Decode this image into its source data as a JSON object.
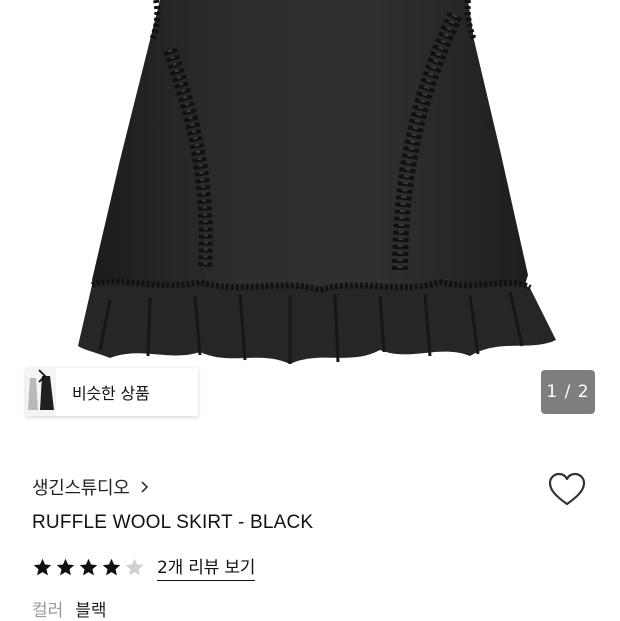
{
  "gallery": {
    "similar_products_label": "비슷한 상품",
    "page_counter": "1 / 2"
  },
  "product": {
    "brand": "생긴스튜디오",
    "title": "RUFFLE WOOL SKIRT - BLACK",
    "rating_stars": 4,
    "rating_max": 5,
    "review_link": "2개 리뷰 보기",
    "option_label": "컬러",
    "option_value": "블랙"
  },
  "colors": {
    "skirt": "#2b2b2b",
    "counter_bg": "#7e7e7e",
    "star_filled": "#111111",
    "star_empty": "#d0d0d0"
  }
}
